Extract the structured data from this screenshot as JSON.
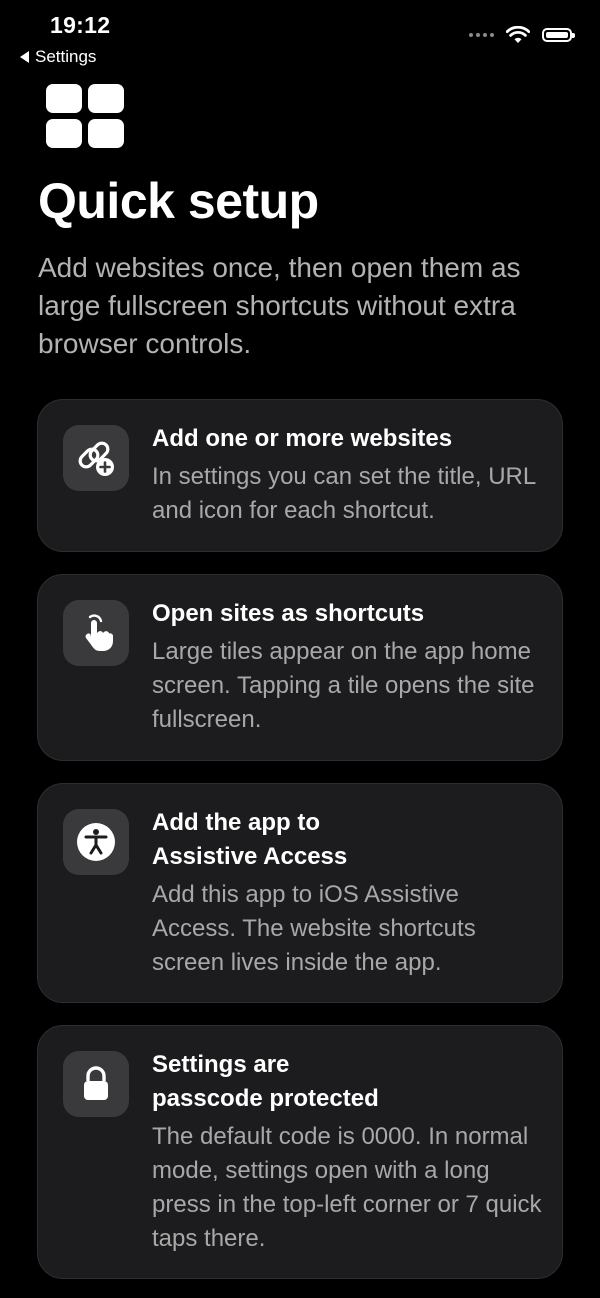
{
  "status_bar": {
    "time": "19:12",
    "back_label": "Settings"
  },
  "page": {
    "title": "Quick setup",
    "subtitle": "Add websites once, then open them as large fullscreen shortcuts without extra browser controls."
  },
  "cards": [
    {
      "icon": "link-plus-icon",
      "title": "Add one or more websites",
      "description": "In settings you can set the title, URL and icon for each shortcut."
    },
    {
      "icon": "hand-tap-icon",
      "title": "Open sites as shortcuts",
      "description": "Large tiles appear on the app home screen. Tapping a tile opens the site fullscreen."
    },
    {
      "icon": "accessibility-icon",
      "title": "Add the app to Assistive Access",
      "description": "Add this app to iOS Assistive Access. The website shortcuts screen lives inside the app."
    },
    {
      "icon": "lock-icon",
      "title": "Settings are passcode protected",
      "description": "The default code is 0000. In normal mode, settings open with a long press in the top-left corner or 7 quick taps there."
    }
  ],
  "colors": {
    "background": "#000000",
    "card": "#1c1c1e",
    "icon_tile": "#3a3a3c",
    "secondary_text": "#a8a8a8"
  }
}
